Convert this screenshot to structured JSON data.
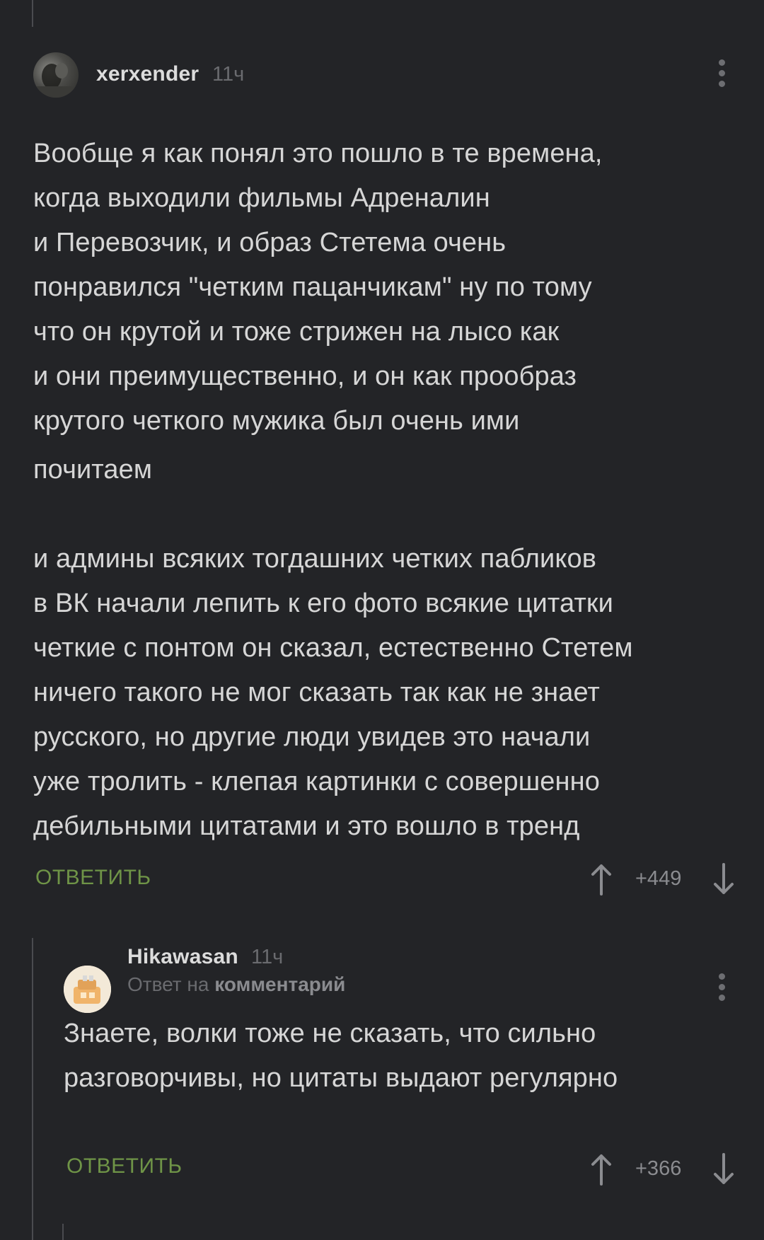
{
  "comments": [
    {
      "username": "xerxender",
      "time": "11ч",
      "text_lines": [
        "Вообще я как понял это пошло в те времена,",
        "когда выходили фильмы Адреналин",
        "и Перевозчик, и образ Стетема очень",
        "понравился \"четким пацанчикам\" ну по тому",
        "что он крутой и тоже стрижен на лысо как",
        "и они преимущественно, и он как прообраз",
        "крутого четкого мужика был очень ими",
        "почитаем",
        "",
        "и админы всяких тогдашних четких пабликов",
        "в ВК начали лепить к его фото всякие цитатки",
        "четкие с понтом он сказал, естественно Стетем",
        "ничего такого не мог сказать так как не знает",
        "русского, но другие люди увидев это начали",
        "уже тролить - клепая картинки с совершенно",
        "дебильными цитатами и это вошло в тренд"
      ],
      "reply_label": "ОТВЕТИТЬ",
      "score": "+449"
    },
    {
      "username": "Hikawasan",
      "time": "11ч",
      "reply_prefix": "Ответ на",
      "reply_target": "комментарий",
      "text_lines": [
        "Знаете, волки тоже не сказать, что сильно",
        "разговорчивы, но цитаты выдают регулярно"
      ],
      "reply_label": "ОТВЕТИТЬ",
      "score": "+366"
    }
  ],
  "colors": {
    "background": "#232427",
    "text": "#d6d6d6",
    "reply_green": "#6f9447",
    "muted": "#6a6b6f"
  },
  "icons": [
    "more-vertical-icon",
    "arrow-up-icon",
    "arrow-down-icon"
  ]
}
